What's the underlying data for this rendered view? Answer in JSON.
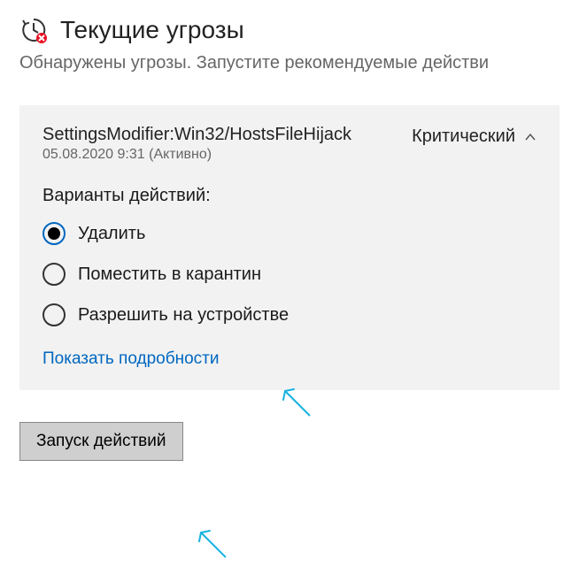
{
  "header": {
    "title": "Текущие угрозы",
    "subtitle": "Обнаружены угрозы. Запустите рекомендуемые действи"
  },
  "threat": {
    "name": "SettingsModifier:Win32/HostsFileHijack",
    "timestamp": "05.08.2020 9:31 (Активно)",
    "severity": "Критический",
    "options_label": "Варианты действий:",
    "options": [
      {
        "label": "Удалить",
        "selected": true
      },
      {
        "label": "Поместить в карантин",
        "selected": false
      },
      {
        "label": "Разрешить на устройстве",
        "selected": false
      }
    ],
    "details_link": "Показать подробности"
  },
  "actions": {
    "run_button": "Запуск действий"
  },
  "colors": {
    "accent": "#0067c0",
    "card_bg": "#f2f2f2",
    "button_bg": "#cfcfcf"
  }
}
